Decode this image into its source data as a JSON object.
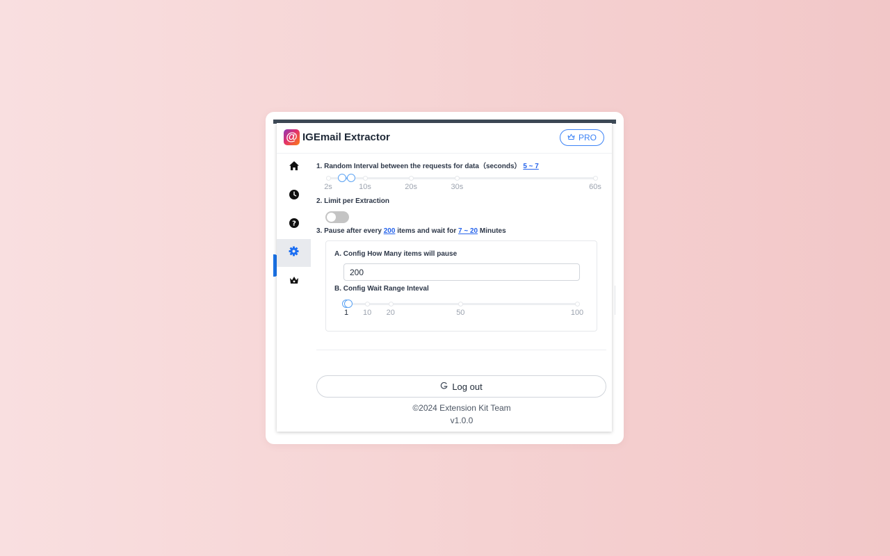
{
  "app": {
    "title": "IGEmail Extractor",
    "logo_glyph": "@",
    "pro_label": "PRO"
  },
  "sidebar": {
    "items": [
      {
        "name": "home",
        "icon": "home-icon"
      },
      {
        "name": "history",
        "icon": "clock-icon"
      },
      {
        "name": "help",
        "icon": "help-circle-icon"
      },
      {
        "name": "settings",
        "icon": "gear-icon",
        "active": true
      },
      {
        "name": "pro",
        "icon": "crown-icon"
      }
    ]
  },
  "settings": {
    "interval": {
      "label": "1. Random Interval between the requests for data（seconds）",
      "value_text": "5 ~ 7",
      "min": 2,
      "max": 60,
      "range": [
        5,
        7
      ],
      "marks": [
        "2s",
        "10s",
        "20s",
        "30s",
        "60s"
      ]
    },
    "limit": {
      "label": "2. Limit per Extraction",
      "enabled": false
    },
    "pause": {
      "label_prefix": "3. Pause after every",
      "count_text": "200",
      "label_middle": "items and wait for",
      "wait_text": "7 ~ 20",
      "label_suffix": "Minutes",
      "config_items_label": "A. Config How Many items will pause",
      "items_value": "200",
      "config_wait_label": "B. Config Wait Range Inteval",
      "wait_min": 1,
      "wait_max": 100,
      "wait_range": [
        1,
        2
      ],
      "wait_marks": [
        "1",
        "10",
        "20",
        "50",
        "100"
      ]
    }
  },
  "logout_label": "Log out",
  "footer": {
    "copyright": "©2024 Extension Kit Team",
    "version": "v1.0.0"
  },
  "colors": {
    "accent": "#3b82f6",
    "slider_track": "#91c1f7",
    "link": "#2563eb"
  }
}
